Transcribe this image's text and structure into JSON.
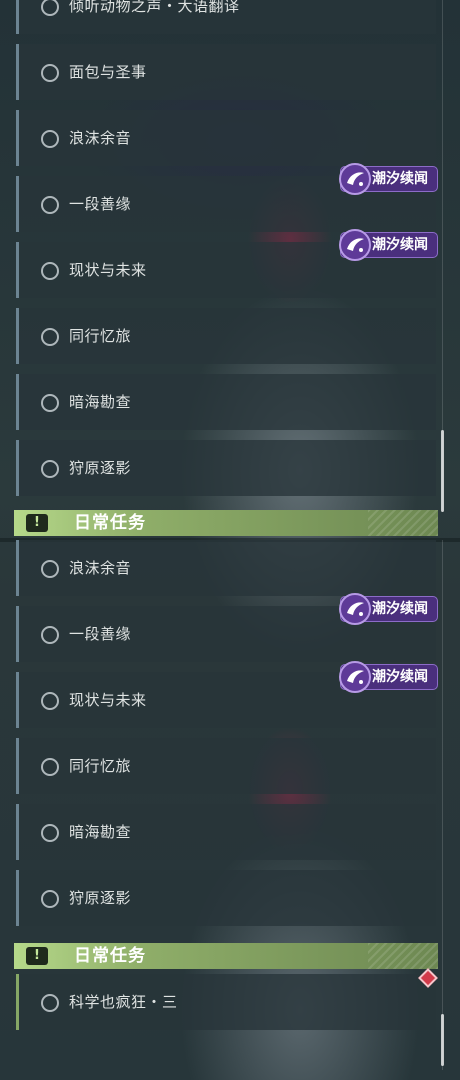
{
  "top": {
    "quests": [
      {
        "label": "倾听动物之声・大语翻译"
      },
      {
        "label": "面包与圣事"
      },
      {
        "label": "浪沫余音"
      },
      {
        "label": "一段善缘"
      },
      {
        "label": "现状与未来"
      },
      {
        "label": "同行忆旅"
      },
      {
        "label": "暗海勘查"
      },
      {
        "label": "狩原逐影"
      }
    ],
    "badges": [
      {
        "text": "潮汐续闻",
        "icon": "tide-echo-icon"
      },
      {
        "text": "潮汐续闻",
        "icon": "tide-echo-icon"
      }
    ],
    "section": {
      "title": "日常任务",
      "icon": "exclamation-icon"
    }
  },
  "bottom": {
    "quests": [
      {
        "label": "浪沫余音"
      },
      {
        "label": "一段善缘"
      },
      {
        "label": "现状与未来"
      },
      {
        "label": "同行忆旅"
      },
      {
        "label": "暗海勘查"
      },
      {
        "label": "狩原逐影"
      }
    ],
    "badges": [
      {
        "text": "潮汐续闻",
        "icon": "tide-echo-icon"
      },
      {
        "text": "潮汐续闻",
        "icon": "tide-echo-icon"
      }
    ],
    "section": {
      "title": "日常任务",
      "icon": "exclamation-icon",
      "icon_glyph": "!"
    },
    "daily_quests": [
      {
        "label": "科学也疯狂・三"
      }
    ]
  },
  "colors": {
    "badge_bg": "#4a2f7d",
    "daily_accent": "#8fae69",
    "quest_accent": "#6c8492",
    "alert": "#d23a4a"
  }
}
